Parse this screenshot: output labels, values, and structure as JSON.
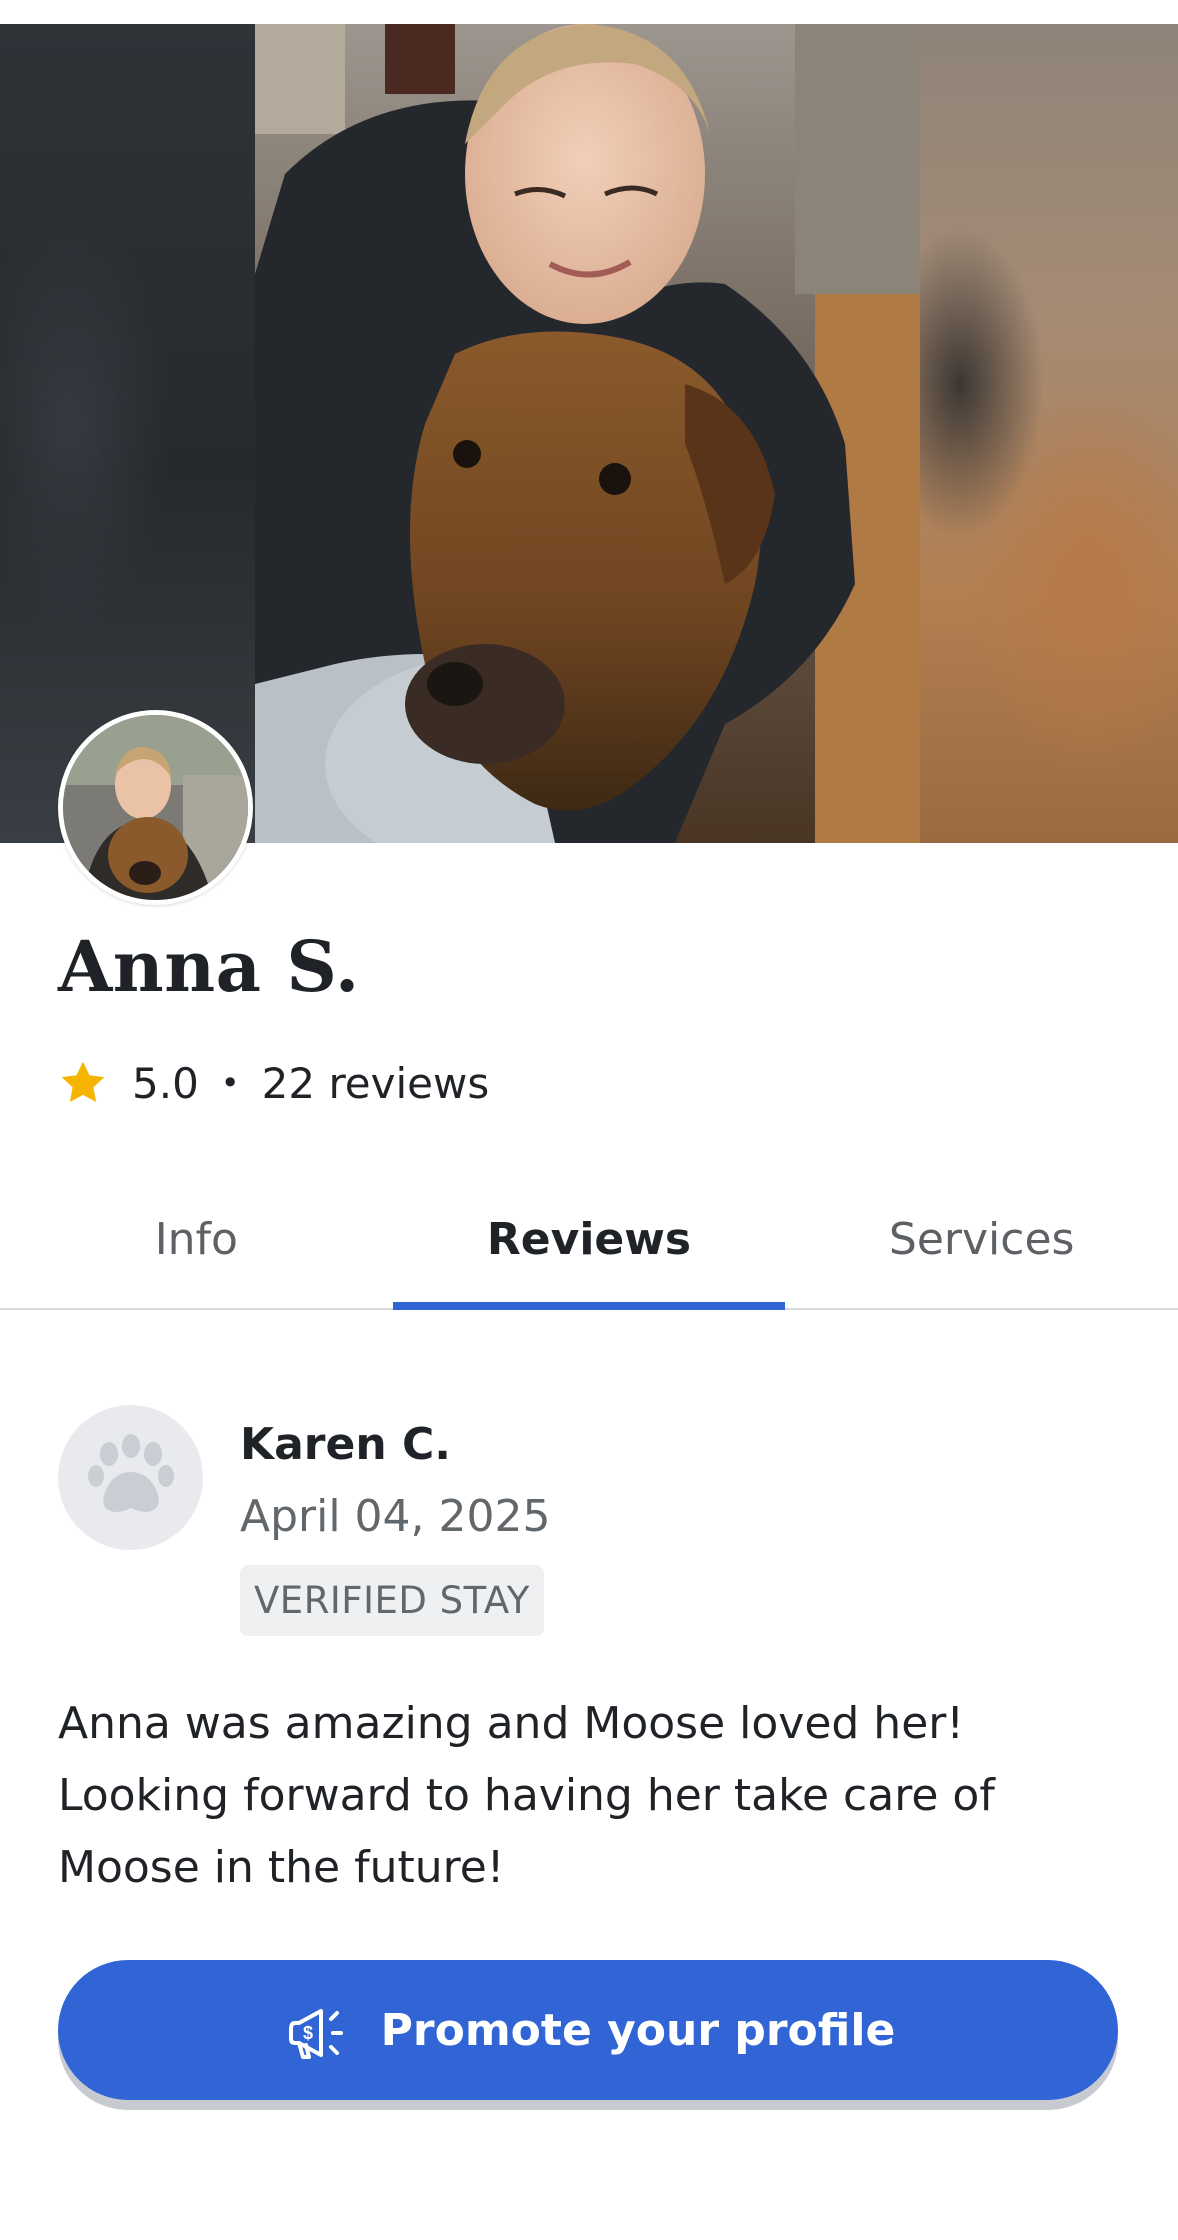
{
  "profile": {
    "name": "Anna S.",
    "rating": "5.0",
    "rating_separator": "•",
    "review_count": "22 reviews"
  },
  "tabs": [
    {
      "label": "Info",
      "active": false
    },
    {
      "label": "Reviews",
      "active": true
    },
    {
      "label": "Services",
      "active": false
    }
  ],
  "review": {
    "reviewer_name": "Karen C.",
    "date": "April 04, 2025",
    "badge": "VERIFIED STAY",
    "text": "Anna was amazing and Moose loved her! Looking forward to having her take care of Moose in the future!"
  },
  "promote_button": {
    "label": "Promote your profile",
    "icon": "megaphone-dollar-icon"
  },
  "colors": {
    "accent": "#3164d4",
    "star": "#f5b400",
    "text_primary": "#1f2327",
    "text_secondary": "#62676c",
    "badge_bg": "#eef0f2"
  },
  "icons": {
    "rating": "star-icon",
    "reviewer_placeholder": "paw-icon"
  }
}
